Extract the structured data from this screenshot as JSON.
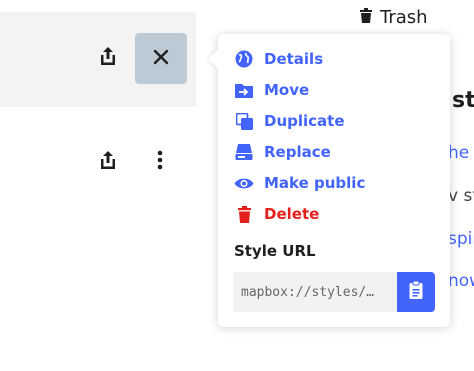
{
  "header": {
    "trash_label": "Trash",
    "trash_icon": "trash-icon"
  },
  "rows": [
    {
      "icons": [
        "share-icon",
        "close-icon"
      ],
      "highlighted": true
    },
    {
      "icons": [
        "share-icon",
        "more-vertical-icon"
      ],
      "highlighted": false
    }
  ],
  "background": {
    "heading_fragment": "st",
    "lines": [
      "he S",
      "v st",
      "spir",
      "now"
    ]
  },
  "menu": {
    "items": [
      {
        "label": "Details",
        "icon": "globe-icon"
      },
      {
        "label": "Move",
        "icon": "move-to-folder-icon"
      },
      {
        "label": "Duplicate",
        "icon": "duplicate-icon"
      },
      {
        "label": "Replace",
        "icon": "replace-icon"
      },
      {
        "label": "Make public",
        "icon": "eye-icon"
      },
      {
        "label": "Delete",
        "icon": "trash-icon"
      }
    ],
    "style_url_label": "Style URL",
    "style_url_value": "mapbox://styles/…",
    "copy_icon": "clipboard-icon"
  },
  "colors": {
    "accent": "#4264fb",
    "danger": "#e3201c",
    "selected_button": "#bccad6",
    "row_highlight": "#f3f3f4"
  }
}
